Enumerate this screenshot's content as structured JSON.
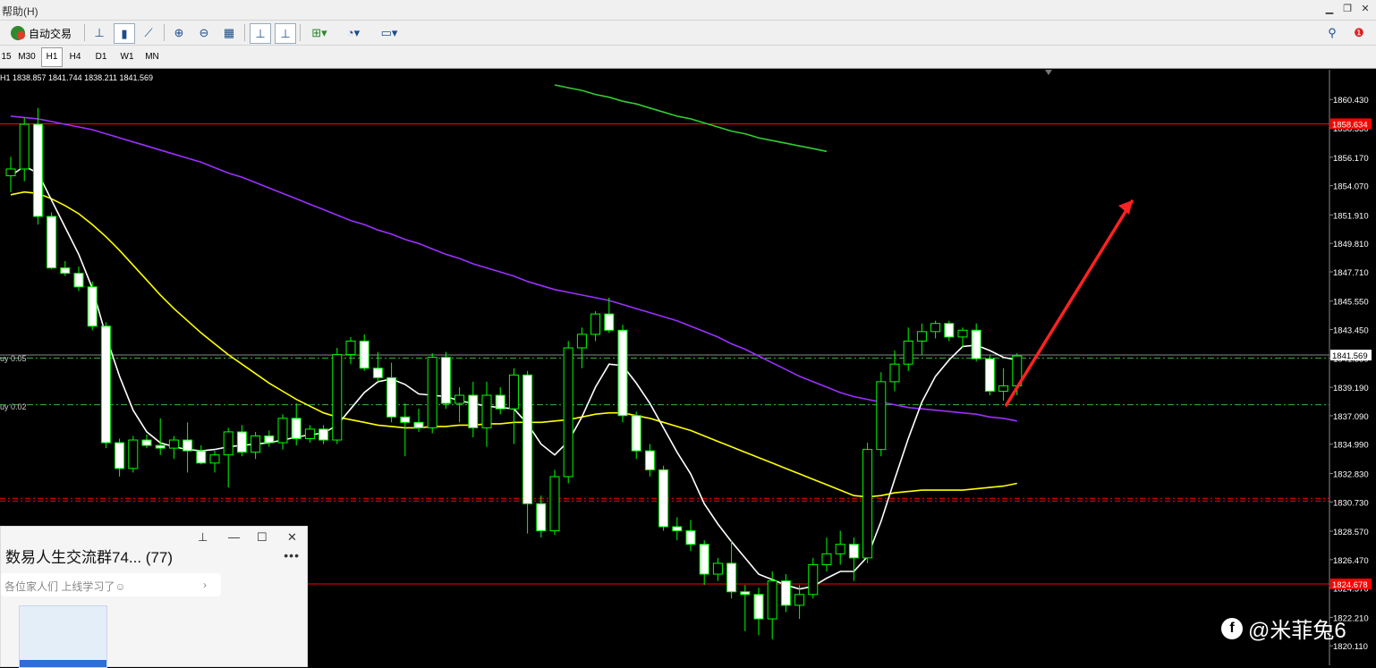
{
  "menubar": {
    "text": "帮助(H)"
  },
  "toolbar": {
    "autotrade_label": "自动交易"
  },
  "timeframes": [
    "15",
    "M30",
    "H1",
    "H4",
    "D1",
    "W1",
    "MN"
  ],
  "timeframe_active": "H1",
  "ohlc_line": "H1  1838.857 1841.744 1838.211 1841.569",
  "order_labels": {
    "buy1": "uy 0.05",
    "buy2": "uy 0.02"
  },
  "price_axis": [
    "1860.430",
    "1858.330",
    "1856.170",
    "1854.070",
    "1851.910",
    "1849.810",
    "1847.710",
    "1845.550",
    "1843.450",
    "1841.350",
    "1839.190",
    "1837.090",
    "1834.990",
    "1832.830",
    "1830.730",
    "1828.570",
    "1826.470",
    "1824.370",
    "1822.210",
    "1820.110"
  ],
  "price_tags": {
    "current": "1841.569",
    "red_upper": "1858.634",
    "red_lower": "1824.678"
  },
  "qq_window": {
    "title": "数易人生交流群74... (77)",
    "subtitle": "各位家人们 上线学习了☺"
  },
  "watermark": "@米菲兔6",
  "colors": {
    "bull": "#00ff00",
    "bear_body": "#ffffff",
    "ma_fast": "#ffffff",
    "ma_yellow": "#ffff00",
    "ma_purple": "#9b30ff",
    "ma_green": "#32cd32",
    "level_red": "#ff0000",
    "arrow": "#ff2222"
  },
  "chart_data": {
    "type": "candlestick",
    "symbol_timeframe": "H1",
    "last": {
      "open": 1838.857,
      "high": 1841.744,
      "low": 1838.211,
      "close": 1841.569
    },
    "yaxis_ticks": [
      1860.43,
      1858.33,
      1856.17,
      1854.07,
      1851.91,
      1849.81,
      1847.71,
      1845.55,
      1843.45,
      1841.35,
      1839.19,
      1837.09,
      1834.99,
      1832.83,
      1830.73,
      1828.57,
      1826.47,
      1824.37,
      1822.21,
      1820.11
    ],
    "ylim": [
      1819.2,
      1861.7
    ],
    "horizontal_levels": [
      1858.634,
      1824.678,
      1831.0
    ],
    "order_levels": [
      1841.35,
      1837.9
    ],
    "candles": [
      [
        1854.8,
        1856.2,
        1853.6,
        1855.3
      ],
      [
        1855.3,
        1859.1,
        1854.4,
        1858.6
      ],
      [
        1858.6,
        1859.8,
        1851.2,
        1851.8
      ],
      [
        1851.8,
        1852.1,
        1847.9,
        1848.0
      ],
      [
        1848.0,
        1848.5,
        1847.4,
        1847.6
      ],
      [
        1847.6,
        1848.1,
        1846.3,
        1846.6
      ],
      [
        1846.6,
        1847.0,
        1843.4,
        1843.7
      ],
      [
        1843.7,
        1844.0,
        1834.7,
        1835.1
      ],
      [
        1835.1,
        1835.4,
        1832.6,
        1833.2
      ],
      [
        1833.2,
        1835.6,
        1832.9,
        1835.3
      ],
      [
        1835.3,
        1835.7,
        1834.7,
        1834.9
      ],
      [
        1834.9,
        1836.9,
        1834.2,
        1834.7
      ],
      [
        1834.7,
        1835.6,
        1833.9,
        1835.3
      ],
      [
        1835.3,
        1836.6,
        1832.9,
        1834.5
      ],
      [
        1834.5,
        1834.9,
        1833.5,
        1833.6
      ],
      [
        1833.6,
        1834.5,
        1832.9,
        1834.2
      ],
      [
        1834.2,
        1836.2,
        1831.8,
        1835.9
      ],
      [
        1835.9,
        1836.4,
        1834.1,
        1834.4
      ],
      [
        1834.4,
        1835.9,
        1833.9,
        1835.6
      ],
      [
        1835.6,
        1836.0,
        1834.8,
        1835.1
      ],
      [
        1835.1,
        1837.2,
        1834.6,
        1836.9
      ],
      [
        1836.9,
        1838.0,
        1834.9,
        1835.4
      ],
      [
        1835.4,
        1836.4,
        1835.1,
        1836.1
      ],
      [
        1836.1,
        1836.4,
        1835.0,
        1835.3
      ],
      [
        1835.3,
        1842.1,
        1835.0,
        1841.6
      ],
      [
        1841.6,
        1842.9,
        1840.9,
        1842.6
      ],
      [
        1842.6,
        1843.1,
        1840.4,
        1840.6
      ],
      [
        1840.6,
        1841.8,
        1839.6,
        1839.9
      ],
      [
        1839.9,
        1841.0,
        1836.6,
        1837.0
      ],
      [
        1837.0,
        1838.0,
        1834.1,
        1836.6
      ],
      [
        1836.6,
        1837.6,
        1835.9,
        1836.2
      ],
      [
        1836.2,
        1841.7,
        1835.8,
        1841.4
      ],
      [
        1841.4,
        1841.8,
        1837.6,
        1838.0
      ],
      [
        1838.0,
        1839.2,
        1836.6,
        1838.6
      ],
      [
        1838.6,
        1839.6,
        1835.5,
        1836.2
      ],
      [
        1836.2,
        1839.6,
        1834.8,
        1838.6
      ],
      [
        1838.6,
        1839.2,
        1837.2,
        1837.6
      ],
      [
        1837.6,
        1840.6,
        1835.0,
        1840.1
      ],
      [
        1840.1,
        1840.4,
        1828.4,
        1830.6
      ],
      [
        1830.6,
        1831.2,
        1828.1,
        1828.6
      ],
      [
        1828.6,
        1833.1,
        1828.3,
        1832.6
      ],
      [
        1832.6,
        1842.6,
        1832.1,
        1842.1
      ],
      [
        1842.1,
        1843.6,
        1840.6,
        1843.1
      ],
      [
        1843.1,
        1844.8,
        1842.6,
        1844.6
      ],
      [
        1844.6,
        1845.8,
        1843.2,
        1843.4
      ],
      [
        1843.4,
        1843.8,
        1836.6,
        1837.1
      ],
      [
        1837.1,
        1837.4,
        1833.9,
        1834.5
      ],
      [
        1834.5,
        1835.0,
        1832.6,
        1833.1
      ],
      [
        1833.1,
        1833.4,
        1828.6,
        1828.9
      ],
      [
        1828.9,
        1829.6,
        1827.9,
        1828.6
      ],
      [
        1828.6,
        1829.4,
        1827.1,
        1827.6
      ],
      [
        1827.6,
        1827.9,
        1824.6,
        1825.4
      ],
      [
        1825.4,
        1826.6,
        1824.9,
        1826.2
      ],
      [
        1826.2,
        1827.9,
        1823.6,
        1824.1
      ],
      [
        1824.1,
        1824.6,
        1821.2,
        1823.9
      ],
      [
        1823.9,
        1824.4,
        1820.9,
        1822.1
      ],
      [
        1822.1,
        1825.6,
        1820.6,
        1824.9
      ],
      [
        1824.9,
        1825.4,
        1822.6,
        1823.1
      ],
      [
        1823.1,
        1824.6,
        1822.1,
        1823.9
      ],
      [
        1823.9,
        1826.6,
        1823.6,
        1826.1
      ],
      [
        1826.1,
        1828.1,
        1825.6,
        1826.9
      ],
      [
        1826.9,
        1828.6,
        1826.1,
        1827.6
      ],
      [
        1827.6,
        1828.1,
        1824.9,
        1826.6
      ],
      [
        1826.6,
        1835.1,
        1826.2,
        1834.6
      ],
      [
        1834.6,
        1840.3,
        1834.1,
        1839.6
      ],
      [
        1839.6,
        1841.9,
        1838.9,
        1840.9
      ],
      [
        1840.9,
        1843.6,
        1840.4,
        1842.6
      ],
      [
        1842.6,
        1843.9,
        1841.6,
        1843.3
      ],
      [
        1843.3,
        1844.1,
        1842.8,
        1843.9
      ],
      [
        1843.9,
        1844.1,
        1842.6,
        1842.9
      ],
      [
        1842.9,
        1843.6,
        1842.1,
        1843.4
      ],
      [
        1843.4,
        1843.9,
        1841.1,
        1841.3
      ],
      [
        1841.3,
        1841.6,
        1838.6,
        1838.9
      ],
      [
        1838.9,
        1840.6,
        1838.2,
        1839.3
      ],
      [
        1839.3,
        1841.7,
        1838.6,
        1841.5
      ]
    ],
    "ma_white": [
      1854.8,
      1855.5,
      1855.0,
      1853.0,
      1851.0,
      1849.0,
      1846.5,
      1843.0,
      1840.0,
      1837.5,
      1835.9,
      1835.1,
      1834.8,
      1834.6,
      1834.5,
      1834.6,
      1834.8,
      1834.9,
      1835.0,
      1835.1,
      1835.3,
      1835.5,
      1835.7,
      1835.8,
      1836.4,
      1837.6,
      1838.8,
      1839.6,
      1839.8,
      1839.4,
      1838.7,
      1838.6,
      1838.5,
      1838.2,
      1838.0,
      1837.8,
      1837.7,
      1837.6,
      1836.5,
      1835.0,
      1834.2,
      1835.2,
      1837.0,
      1839.2,
      1840.9,
      1840.8,
      1839.5,
      1838.0,
      1836.2,
      1834.4,
      1832.8,
      1830.6,
      1829.1,
      1827.8,
      1826.6,
      1825.4,
      1825.0,
      1824.6,
      1824.3,
      1824.5,
      1825.1,
      1825.6,
      1825.6,
      1826.7,
      1829.3,
      1832.4,
      1835.4,
      1838.1,
      1840.0,
      1841.2,
      1842.2,
      1842.3,
      1841.9,
      1841.4,
      1841.2
    ],
    "ma_yellow": [
      1853.4,
      1853.6,
      1853.5,
      1853.1,
      1852.6,
      1852.0,
      1851.2,
      1850.3,
      1849.3,
      1848.2,
      1847.1,
      1846.0,
      1845.0,
      1844.1,
      1843.2,
      1842.4,
      1841.6,
      1840.9,
      1840.2,
      1839.5,
      1838.9,
      1838.3,
      1837.8,
      1837.3,
      1837.0,
      1836.8,
      1836.6,
      1836.4,
      1836.3,
      1836.2,
      1836.2,
      1836.3,
      1836.3,
      1836.4,
      1836.4,
      1836.5,
      1836.5,
      1836.6,
      1836.6,
      1836.6,
      1836.7,
      1836.8,
      1837.0,
      1837.2,
      1837.3,
      1837.3,
      1837.1,
      1836.9,
      1836.6,
      1836.3,
      1836.0,
      1835.6,
      1835.2,
      1834.8,
      1834.4,
      1834.0,
      1833.6,
      1833.2,
      1832.8,
      1832.4,
      1832.0,
      1831.6,
      1831.2,
      1831.1,
      1831.2,
      1831.4,
      1831.5,
      1831.6,
      1831.6,
      1831.6,
      1831.6,
      1831.7,
      1831.8,
      1831.9,
      1832.1
    ],
    "ma_purple": [
      1859.2,
      1859.1,
      1859.0,
      1858.8,
      1858.6,
      1858.4,
      1858.2,
      1857.9,
      1857.6,
      1857.3,
      1857.0,
      1856.7,
      1856.4,
      1856.1,
      1855.8,
      1855.4,
      1855.0,
      1854.7,
      1854.3,
      1853.9,
      1853.5,
      1853.1,
      1852.7,
      1852.3,
      1851.9,
      1851.5,
      1851.2,
      1850.8,
      1850.5,
      1850.1,
      1849.8,
      1849.4,
      1849.0,
      1848.7,
      1848.3,
      1848.0,
      1847.7,
      1847.4,
      1847.0,
      1846.7,
      1846.4,
      1846.2,
      1846.0,
      1845.8,
      1845.6,
      1845.3,
      1845.0,
      1844.7,
      1844.4,
      1844.1,
      1843.7,
      1843.3,
      1842.9,
      1842.4,
      1842.0,
      1841.5,
      1841.0,
      1840.5,
      1840.0,
      1839.6,
      1839.2,
      1838.8,
      1838.5,
      1838.3,
      1838.1,
      1837.9,
      1837.7,
      1837.6,
      1837.5,
      1837.4,
      1837.3,
      1837.2,
      1837.0,
      1836.9,
      1836.7
    ],
    "ma_green": [
      1861.5,
      1861.3,
      1861.1,
      1860.8,
      1860.6,
      1860.3,
      1860.1,
      1859.8,
      1859.5,
      1859.2,
      1859.0,
      1858.7,
      1858.4,
      1858.1,
      1857.9,
      1857.6,
      1857.4,
      1857.2,
      1857.0,
      1856.8,
      1856.6
    ]
  }
}
